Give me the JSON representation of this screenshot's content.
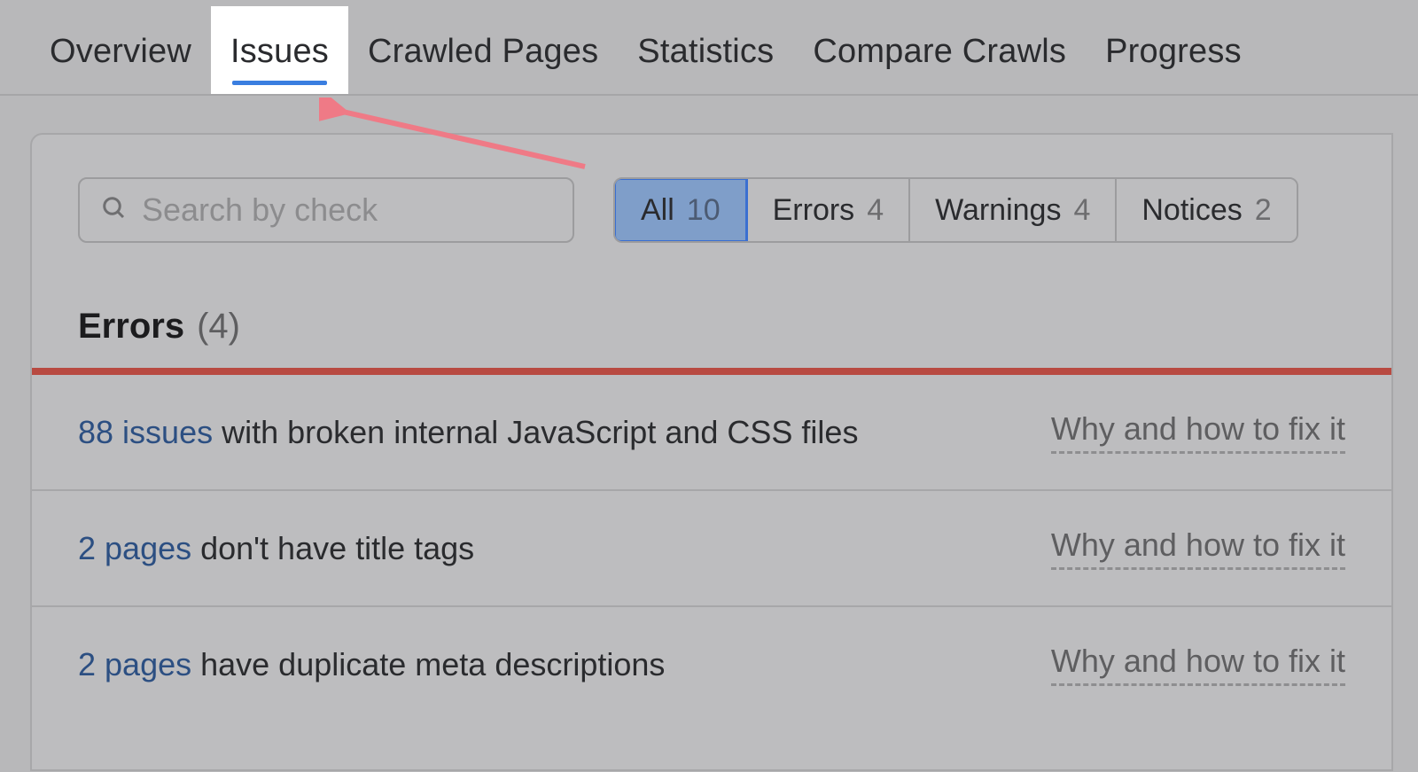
{
  "tabs": [
    {
      "label": "Overview",
      "active": false
    },
    {
      "label": "Issues",
      "active": true
    },
    {
      "label": "Crawled Pages",
      "active": false
    },
    {
      "label": "Statistics",
      "active": false
    },
    {
      "label": "Compare Crawls",
      "active": false
    },
    {
      "label": "Progress",
      "active": false
    }
  ],
  "search": {
    "placeholder": "Search by check"
  },
  "filters": [
    {
      "label": "All",
      "count": "10",
      "active": true
    },
    {
      "label": "Errors",
      "count": "4",
      "active": false
    },
    {
      "label": "Warnings",
      "count": "4",
      "active": false
    },
    {
      "label": "Notices",
      "count": "2",
      "active": false
    }
  ],
  "section": {
    "title": "Errors",
    "count": "(4)"
  },
  "fix_label": "Why and how to fix it",
  "issues": [
    {
      "lead": "88 issues",
      "rest": "with broken internal JavaScript and CSS files"
    },
    {
      "lead": "2 pages",
      "rest": "don't have title tags"
    },
    {
      "lead": "2 pages",
      "rest": "have duplicate meta descriptions"
    }
  ]
}
